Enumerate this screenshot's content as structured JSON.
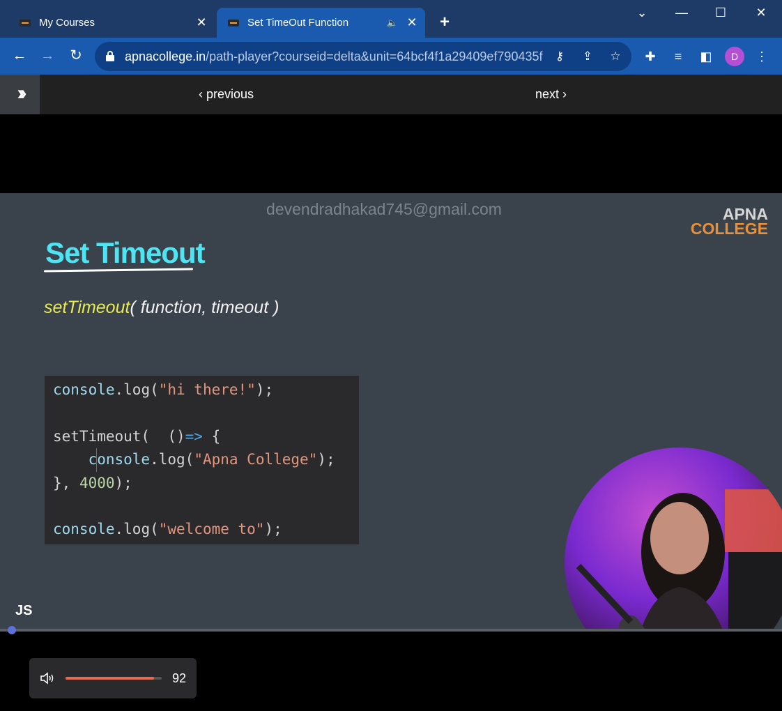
{
  "browser": {
    "tabs": [
      {
        "title": "My Courses",
        "active": false
      },
      {
        "title": "Set TimeOut Function",
        "active": true
      }
    ],
    "url_domain": "apnacollege.in",
    "url_rest": "/path-player?courseid=delta&unit=64bcf4f1a29409ef790435f...",
    "profile_initial": "D",
    "profile_color": "#b44fd6"
  },
  "pagebar": {
    "previous_label": "previous",
    "next_label": "next"
  },
  "slide": {
    "watermark": "devendradhakad745@gmail.com",
    "logo_line1": "APNA",
    "logo_line2": "COLLEGE",
    "title": "Set Timeout",
    "signature_fn": "setTimeout",
    "signature_args": "( function, timeout )",
    "code": {
      "line1": {
        "obj": "console",
        "dot": ".log(",
        "str": "\"hi there!\"",
        "end": ");"
      },
      "line3": {
        "fn": "setTimeout(  ()",
        "arrow": "=>",
        "brace": " {"
      },
      "line4": {
        "indent": "    ",
        "obj": "console",
        "dot": ".log(",
        "str": "\"Apna College\"",
        "end": ");"
      },
      "line5": {
        "start": "}, ",
        "num": "4000",
        "end": ");"
      },
      "line7": {
        "obj": "console",
        "dot": ".log(",
        "str": "\"welcome to\"",
        "end": ");"
      }
    },
    "badge": "JS"
  },
  "player": {
    "progress": 0.01,
    "volume": 92,
    "volume_label": "92",
    "volume_color": "#e76b4f",
    "accent": "#5d70d8"
  }
}
